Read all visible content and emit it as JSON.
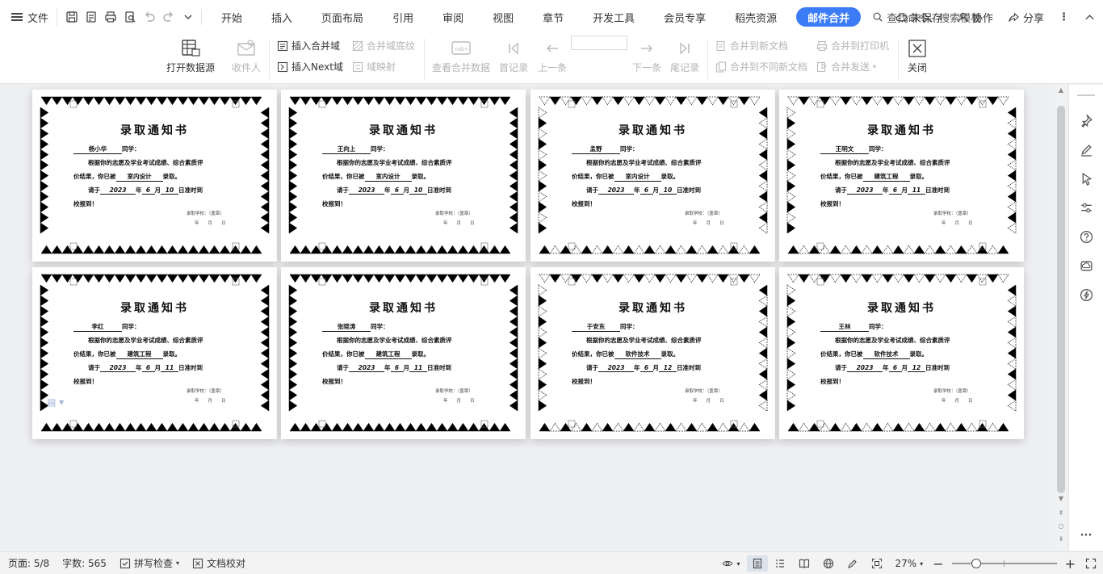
{
  "tabbar": {
    "file_label": "文件",
    "tabs": [
      "开始",
      "插入",
      "页面布局",
      "引用",
      "审阅",
      "视图",
      "章节",
      "开发工具",
      "会员专享",
      "稻壳资源"
    ],
    "active_tab": "邮件合并",
    "search_label": "查找命令、搜索模板",
    "unsaved_label": "未保存",
    "collab_label": "协作",
    "share_label": "分享"
  },
  "ribbon": {
    "open_datasource": "打开数据源",
    "recipients": "收件人",
    "insert_merge_field": "插入合并域",
    "insert_next": "插入Next域",
    "merge_field_shading": "合并域底纹",
    "field_mapping": "域映射",
    "view_merged_data": "查看合并数据",
    "first_record": "首记录",
    "prev_record": "上一条",
    "next_record": "下一条",
    "last_record": "尾记录",
    "merge_to_new_doc": "合并到新文档",
    "merge_to_diff_docs": "合并到不同新文档",
    "merge_to_printer": "合并到打印机",
    "merge_send": "合并发送",
    "close": "关闭"
  },
  "certificate": {
    "title": "录取通知书",
    "classmate": "同学：",
    "line1": "根据你的志愿及学业考试成绩、综合素质评",
    "line2a": "价结果，你已被",
    "line2b": "录取。",
    "line3a": "请于",
    "year_suffix": "年",
    "month_suffix": "月",
    "day_suffix": "日准时到",
    "line4": "校报到！",
    "school_seal": "录取学校：（盖章）",
    "date_blank": "年　　月　　日"
  },
  "pages": [
    {
      "name": "杨小华",
      "major": "室内设计",
      "year": "2023",
      "month": "6",
      "day": "10"
    },
    {
      "name": "王向上",
      "major": "室内设计",
      "year": "2023",
      "month": "6",
      "day": "10"
    },
    {
      "name": "孟野",
      "major": "室内设计",
      "year": "2023",
      "month": "6",
      "day": "10"
    },
    {
      "name": "王明文",
      "major": "建筑工程",
      "year": "2023",
      "month": "6",
      "day": "11"
    },
    {
      "name": "李红",
      "major": "建筑工程",
      "year": "2023",
      "month": "6",
      "day": "11"
    },
    {
      "name": "张晓涛",
      "major": "建筑工程",
      "year": "2023",
      "month": "6",
      "day": "11"
    },
    {
      "name": "于安东",
      "major": "软件技术",
      "year": "2023",
      "month": "6",
      "day": "12"
    },
    {
      "name": "王林",
      "major": "软件技术",
      "year": "2023",
      "month": "6",
      "day": "12"
    }
  ],
  "status": {
    "page": "页面: 5/8",
    "words": "字数: 565",
    "spellcheck": "拼写检查",
    "proofread": "文档校对",
    "zoom": "27%"
  }
}
